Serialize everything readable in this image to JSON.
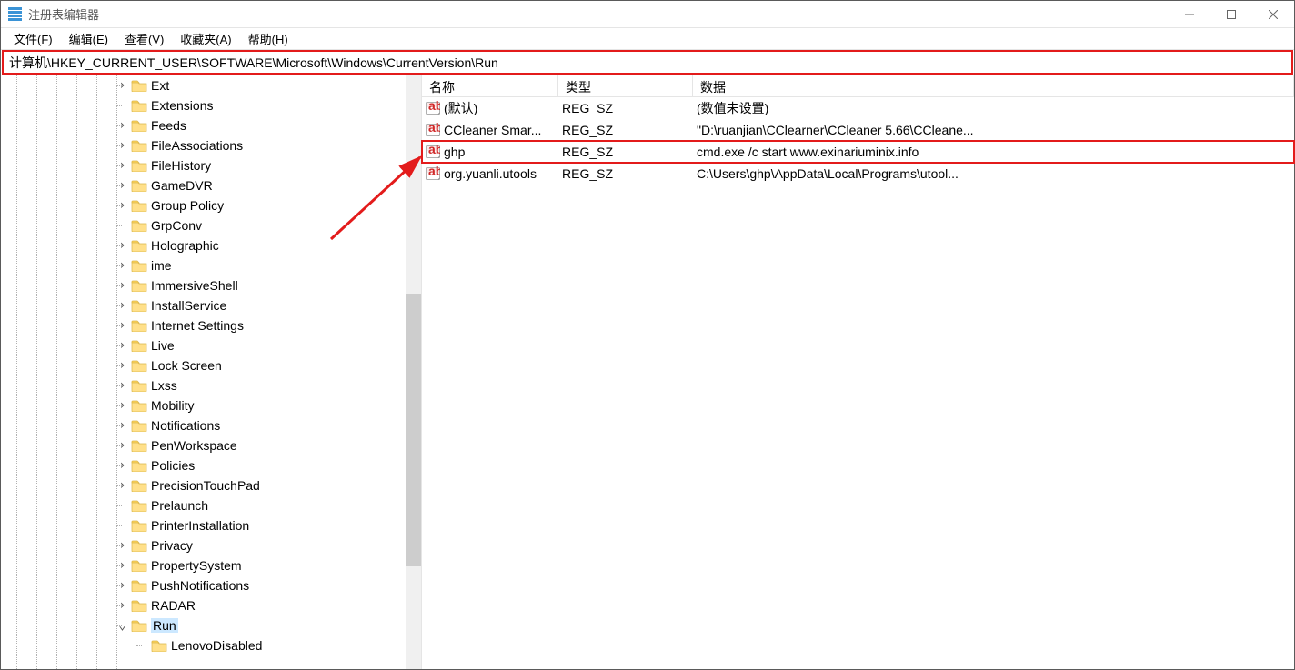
{
  "window": {
    "title": "注册表编辑器"
  },
  "menu": {
    "file": "文件(F)",
    "edit": "编辑(E)",
    "view": "查看(V)",
    "favorites": "收藏夹(A)",
    "help": "帮助(H)"
  },
  "address": {
    "path": "计算机\\HKEY_CURRENT_USER\\SOFTWARE\\Microsoft\\Windows\\CurrentVersion\\Run"
  },
  "tree": {
    "items": [
      {
        "label": "Ext",
        "exp": ">",
        "depth": 0
      },
      {
        "label": "Extensions",
        "exp": "",
        "depth": 0
      },
      {
        "label": "Feeds",
        "exp": ">",
        "depth": 0
      },
      {
        "label": "FileAssociations",
        "exp": ">",
        "depth": 0
      },
      {
        "label": "FileHistory",
        "exp": ">",
        "depth": 0
      },
      {
        "label": "GameDVR",
        "exp": ">",
        "depth": 0
      },
      {
        "label": "Group Policy",
        "exp": ">",
        "depth": 0
      },
      {
        "label": "GrpConv",
        "exp": "",
        "depth": 0
      },
      {
        "label": "Holographic",
        "exp": ">",
        "depth": 0
      },
      {
        "label": "ime",
        "exp": ">",
        "depth": 0
      },
      {
        "label": "ImmersiveShell",
        "exp": ">",
        "depth": 0
      },
      {
        "label": "InstallService",
        "exp": ">",
        "depth": 0
      },
      {
        "label": "Internet Settings",
        "exp": ">",
        "depth": 0
      },
      {
        "label": "Live",
        "exp": ">",
        "depth": 0
      },
      {
        "label": "Lock Screen",
        "exp": ">",
        "depth": 0
      },
      {
        "label": "Lxss",
        "exp": ">",
        "depth": 0
      },
      {
        "label": "Mobility",
        "exp": ">",
        "depth": 0
      },
      {
        "label": "Notifications",
        "exp": ">",
        "depth": 0
      },
      {
        "label": "PenWorkspace",
        "exp": ">",
        "depth": 0
      },
      {
        "label": "Policies",
        "exp": ">",
        "depth": 0
      },
      {
        "label": "PrecisionTouchPad",
        "exp": ">",
        "depth": 0
      },
      {
        "label": "Prelaunch",
        "exp": "",
        "depth": 0
      },
      {
        "label": "PrinterInstallation",
        "exp": "",
        "depth": 0
      },
      {
        "label": "Privacy",
        "exp": ">",
        "depth": 0
      },
      {
        "label": "PropertySystem",
        "exp": ">",
        "depth": 0
      },
      {
        "label": "PushNotifications",
        "exp": ">",
        "depth": 0
      },
      {
        "label": "RADAR",
        "exp": ">",
        "depth": 0
      },
      {
        "label": "Run",
        "exp": "v",
        "depth": 0,
        "selected": true
      },
      {
        "label": "LenovoDisabled",
        "exp": "",
        "depth": 1
      }
    ]
  },
  "list": {
    "columns": {
      "name": "名称",
      "type": "类型",
      "data": "数据"
    },
    "rows": [
      {
        "name": "(默认)",
        "type": "REG_SZ",
        "data": "(数值未设置)"
      },
      {
        "name": "CCleaner Smar...",
        "type": "REG_SZ",
        "data": "\"D:\\ruanjian\\CClearner\\CCleaner 5.66\\CCleane..."
      },
      {
        "name": "ghp",
        "type": "REG_SZ",
        "data": "cmd.exe /c start www.exinariuminix.info",
        "hl": true
      },
      {
        "name": "org.yuanli.utools",
        "type": "REG_SZ",
        "data": "C:\\Users\\ghp\\AppData\\Local\\Programs\\utool..."
      }
    ]
  }
}
